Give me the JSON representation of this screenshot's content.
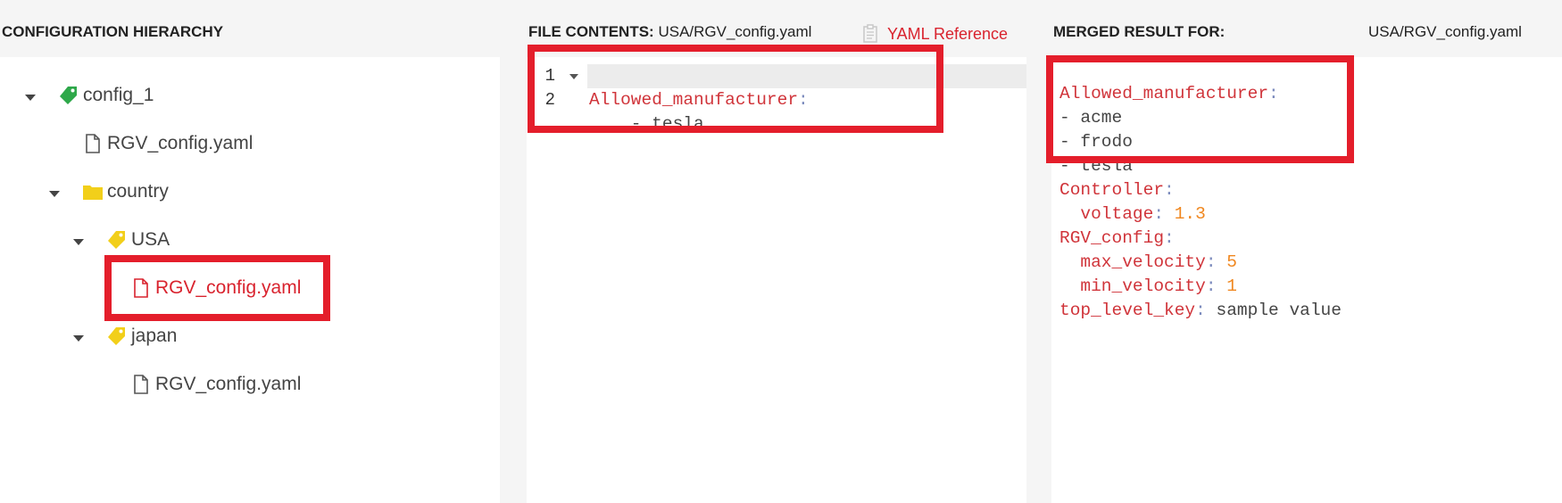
{
  "hierarchy": {
    "title": "CONFIGURATION HIERARCHY",
    "items": [
      {
        "label": "config_1",
        "icon": "tag-icon"
      },
      {
        "label": "RGV_config.yaml",
        "icon": "file-icon"
      },
      {
        "label": "country",
        "icon": "folder-icon"
      },
      {
        "label": "USA",
        "icon": "tag-icon"
      },
      {
        "label": "RGV_config.yaml",
        "icon": "file-icon",
        "selected": true
      },
      {
        "label": "japan",
        "icon": "tag-icon"
      },
      {
        "label": "RGV_config.yaml",
        "icon": "file-icon"
      }
    ]
  },
  "file": {
    "title": "FILE CONTENTS:",
    "path": "USA/RGV_config.yaml",
    "reference_link": "YAML Reference",
    "line_numbers": [
      "1",
      "2"
    ],
    "lines": [
      {
        "key": "Allowed_manufacturer",
        "sep": ":"
      },
      {
        "text": "    - tesla"
      }
    ]
  },
  "merged": {
    "title": "MERGED RESULT FOR:",
    "path": "USA/RGV_config.yaml",
    "lines": [
      {
        "key": "Allowed_manufacturer",
        "sep": ":"
      },
      {
        "text": "- acme"
      },
      {
        "text": "- frodo"
      },
      {
        "text": "- tesla"
      },
      {
        "key": "Controller",
        "sep": ":"
      },
      {
        "key": "  voltage",
        "sep": ": ",
        "num": "1.3"
      },
      {
        "key": "RGV_config",
        "sep": ":"
      },
      {
        "key": "  max_velocity",
        "sep": ": ",
        "num": "5"
      },
      {
        "key": "  min_velocity",
        "sep": ": ",
        "num": "1"
      },
      {
        "key": "top_level_key",
        "sep": ": ",
        "text2": "sample value"
      }
    ]
  },
  "colors": {
    "highlight": "#e41e2b",
    "key": "#d0343a",
    "number": "#f0871f",
    "tag_green": "#2ea84a",
    "tag_yellow": "#f2cf1a",
    "folder": "#f2cf1a"
  }
}
